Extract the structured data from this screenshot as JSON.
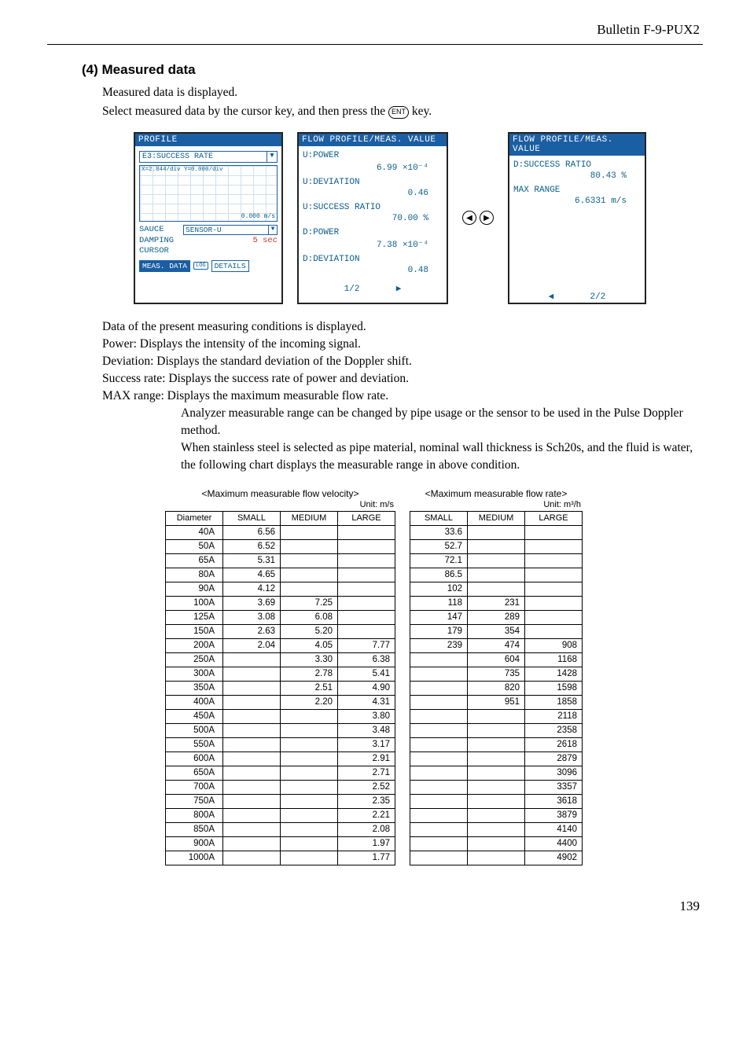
{
  "doc": {
    "header": "Bulletin F-9-PUX2",
    "section_num": "(4)",
    "section_title": "Measured data",
    "intro1": "Measured data is displayed.",
    "intro2a": "Select measured data by the cursor key, and then press the ",
    "intro2b": " key.",
    "ent": "ENT",
    "page": "139"
  },
  "panelA": {
    "title": "PROFILE",
    "dd1": "E3:SUCCESS RATE",
    "xy": "X=2.844/div Y=0.000/div",
    "graph_val": "0.000 m/s",
    "sauce": "SAUCE",
    "sauce_dd": "SENSOR-U",
    "damping_k": "DAMPING",
    "damping_v": "5 sec",
    "cursor": "CURSOR",
    "btn1": "MEAS. DATA",
    "log": "LOG",
    "btn2": "DETAILS"
  },
  "panelB": {
    "title": "FLOW PROFILE/MEAS. VALUE",
    "l1": "U:POWER",
    "v1": "6.99 ×10⁻⁴",
    "l2": "U:DEVIATION",
    "v2": "0.46",
    "l3": "U:SUCCESS RATIO",
    "v3": "70.00 %",
    "l4": "D:POWER",
    "v4": "7.38 ×10⁻⁴",
    "l5": "D:DEVIATION",
    "v5": "0.48",
    "pager": "1/2"
  },
  "panelC": {
    "title": "FLOW PROFILE/MEAS. VALUE",
    "l1": "D:SUCCESS RATIO",
    "v1": "80.43 %",
    "l2": "MAX RANGE",
    "v2": "6.6331 m/s",
    "pager": "2/2"
  },
  "descr": {
    "d0": "Data of the present measuring conditions is displayed.",
    "d1": "Power: Displays the intensity of the incoming signal.",
    "d2": "Deviation: Displays the standard deviation of the Doppler shift.",
    "d3": "Success rate: Displays the success rate of power and deviation.",
    "d4": "MAX range: Displays the maximum measurable flow rate.",
    "i1": "Analyzer measurable range can be changed by pipe usage or the sensor to be used in the Pulse Doppler method.",
    "i2": "When stainless steel is selected as pipe material, nominal wall thickness is Sch20s, and the fluid is water, the following chart displays the measurable range in above condition."
  },
  "tables": {
    "cap_v": "<Maximum measurable flow velocity>",
    "unit_v": "Unit: m/s",
    "cap_r": "<Maximum measurable flow rate>",
    "unit_r": "Unit: m³/h",
    "h_diam": "Diameter",
    "h_small": "SMALL",
    "h_medium": "MEDIUM",
    "h_large": "LARGE"
  },
  "chart_data": [
    {
      "type": "table",
      "title": "Maximum measurable flow velocity",
      "unit": "m/s",
      "columns": [
        "Diameter",
        "SMALL",
        "MEDIUM",
        "LARGE"
      ],
      "rows": [
        [
          "40A",
          6.56,
          null,
          null
        ],
        [
          "50A",
          6.52,
          null,
          null
        ],
        [
          "65A",
          5.31,
          null,
          null
        ],
        [
          "80A",
          4.65,
          null,
          null
        ],
        [
          "90A",
          4.12,
          null,
          null
        ],
        [
          "100A",
          3.69,
          7.25,
          null
        ],
        [
          "125A",
          3.08,
          6.08,
          null
        ],
        [
          "150A",
          2.63,
          5.2,
          null
        ],
        [
          "200A",
          2.04,
          4.05,
          7.77
        ],
        [
          "250A",
          null,
          3.3,
          6.38
        ],
        [
          "300A",
          null,
          2.78,
          5.41
        ],
        [
          "350A",
          null,
          2.51,
          4.9
        ],
        [
          "400A",
          null,
          2.2,
          4.31
        ],
        [
          "450A",
          null,
          null,
          3.8
        ],
        [
          "500A",
          null,
          null,
          3.48
        ],
        [
          "550A",
          null,
          null,
          3.17
        ],
        [
          "600A",
          null,
          null,
          2.91
        ],
        [
          "650A",
          null,
          null,
          2.71
        ],
        [
          "700A",
          null,
          null,
          2.52
        ],
        [
          "750A",
          null,
          null,
          2.35
        ],
        [
          "800A",
          null,
          null,
          2.21
        ],
        [
          "850A",
          null,
          null,
          2.08
        ],
        [
          "900A",
          null,
          null,
          1.97
        ],
        [
          "1000A",
          null,
          null,
          1.77
        ]
      ]
    },
    {
      "type": "table",
      "title": "Maximum measurable flow rate",
      "unit": "m³/h",
      "columns": [
        "SMALL",
        "MEDIUM",
        "LARGE"
      ],
      "rows": [
        [
          33.6,
          null,
          null
        ],
        [
          52.7,
          null,
          null
        ],
        [
          72.1,
          null,
          null
        ],
        [
          86.5,
          null,
          null
        ],
        [
          102,
          null,
          null
        ],
        [
          118,
          231,
          null
        ],
        [
          147,
          289,
          null
        ],
        [
          179,
          354,
          null
        ],
        [
          239,
          474,
          908
        ],
        [
          null,
          604,
          1168
        ],
        [
          null,
          735,
          1428
        ],
        [
          null,
          820,
          1598
        ],
        [
          null,
          951,
          1858
        ],
        [
          null,
          null,
          2118
        ],
        [
          null,
          null,
          2358
        ],
        [
          null,
          null,
          2618
        ],
        [
          null,
          null,
          2879
        ],
        [
          null,
          null,
          3096
        ],
        [
          null,
          null,
          3357
        ],
        [
          null,
          null,
          3618
        ],
        [
          null,
          null,
          3879
        ],
        [
          null,
          null,
          4140
        ],
        [
          null,
          null,
          4400
        ],
        [
          null,
          null,
          4902
        ]
      ]
    }
  ]
}
